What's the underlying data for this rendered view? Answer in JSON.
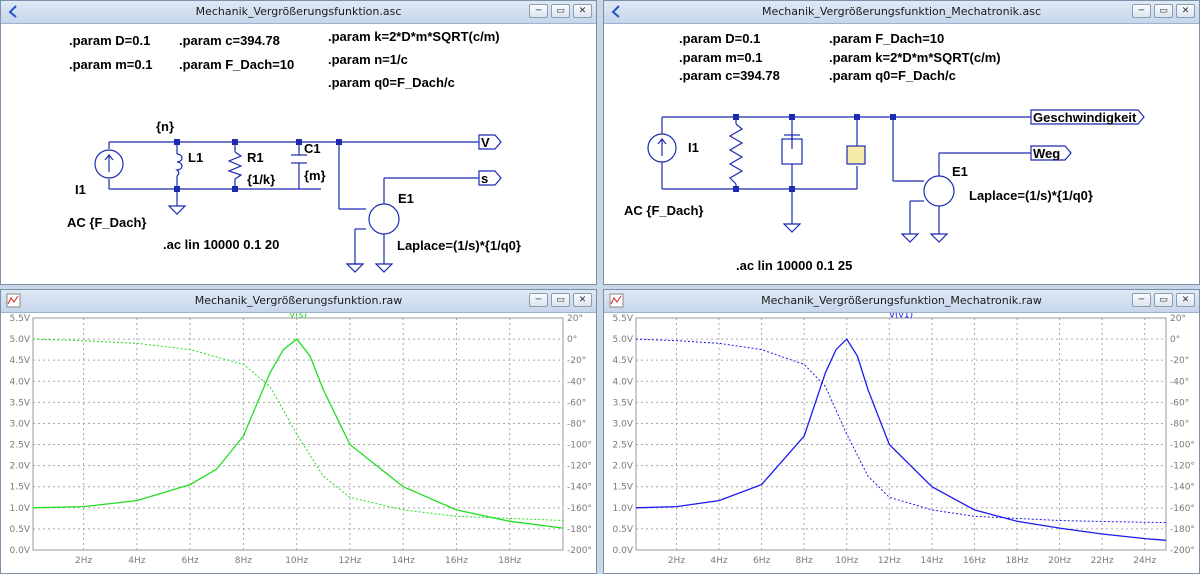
{
  "windows": {
    "sch1": {
      "title": "Mechanik_Vergrößerungsfunktion.asc",
      "params": [
        ".param D=0.1",
        ".param c=394.78",
        ".param k=2*D*m*SQRT(c/m)",
        ".param m=0.1",
        ".param F_Dach=10",
        ".param n=1/c",
        ".param q0=F_Dach/c"
      ],
      "labels": {
        "n": "{n}",
        "L1": "L1",
        "R1": "R1",
        "k": "{1/k}",
        "C1": "C1",
        "m": "{m}",
        "I1": "I1",
        "ac_source": "AC {F_Dach}",
        "V": "V",
        "s": "s",
        "E1": "E1",
        "laplace": "Laplace=(1/s)*{1/q0}",
        "ac_cmd": ".ac lin 10000 0.1 20"
      }
    },
    "sch2": {
      "title": "Mechanik_Vergrößerungsfunktion_Mechatronik.asc",
      "params": [
        ".param D=0.1",
        ".param F_Dach=10",
        ".param m=0.1",
        ".param k=2*D*m*SQRT(c/m)",
        ".param c=394.78",
        ".param q0=F_Dach/c"
      ],
      "labels": {
        "I1": "I1",
        "ac_source": "AC {F_Dach}",
        "geschw": "Geschwindigkeit",
        "weg": "Weg",
        "E1": "E1",
        "laplace": "Laplace=(1/s)*{1/q0}",
        "ac_cmd": ".ac lin 10000 0.1 25"
      }
    },
    "plot1": {
      "title": "Mechanik_Vergrößerungsfunktion.raw",
      "trace_label": "V(s)",
      "color": "#22dd22",
      "y_ticks": [
        "5.5V",
        "5.0V",
        "4.5V",
        "4.0V",
        "3.5V",
        "3.0V",
        "2.5V",
        "2.0V",
        "1.5V",
        "1.0V",
        "0.5V",
        "0.0V"
      ],
      "phase_ticks": [
        "20°",
        "0°",
        "-20°",
        "-40°",
        "-60°",
        "-80°",
        "-100°",
        "-120°",
        "-140°",
        "-160°",
        "-180°",
        "-200°"
      ],
      "x_ticks": [
        "2Hz",
        "4Hz",
        "6Hz",
        "8Hz",
        "10Hz",
        "12Hz",
        "14Hz",
        "16Hz",
        "18Hz"
      ]
    },
    "plot2": {
      "title": "Mechanik_Vergrößerungsfunktion_Mechatronik.raw",
      "trace_label": "V(v1)",
      "color": "#1a1aee",
      "y_ticks": [
        "5.5V",
        "5.0V",
        "4.5V",
        "4.0V",
        "3.5V",
        "3.0V",
        "2.5V",
        "2.0V",
        "1.5V",
        "1.0V",
        "0.5V",
        "0.0V"
      ],
      "phase_ticks": [
        "20°",
        "0°",
        "-20°",
        "-40°",
        "-60°",
        "-80°",
        "-100°",
        "-120°",
        "-140°",
        "-160°",
        "-180°",
        "-200°"
      ],
      "x_ticks": [
        "2Hz",
        "4Hz",
        "6Hz",
        "8Hz",
        "10Hz",
        "12Hz",
        "14Hz",
        "16Hz",
        "18Hz",
        "20Hz",
        "22Hz",
        "24Hz"
      ]
    }
  },
  "chart_data": [
    {
      "type": "line",
      "title": "",
      "series": [
        {
          "name": "V(s)",
          "kind": "magnitude",
          "unit": "V",
          "x": [
            0.1,
            2,
            4,
            6,
            7,
            8,
            9,
            9.5,
            10,
            10.5,
            11,
            12,
            14,
            16,
            18,
            20
          ],
          "values": [
            1.0,
            1.03,
            1.17,
            1.55,
            1.92,
            2.7,
            4.2,
            4.75,
            5.0,
            4.6,
            3.8,
            2.5,
            1.5,
            0.95,
            0.68,
            0.52
          ]
        },
        {
          "name": "V(s) phase",
          "kind": "phase",
          "unit": "deg",
          "x": [
            0.1,
            2,
            4,
            6,
            8,
            9,
            10,
            11,
            12,
            14,
            16,
            18,
            20
          ],
          "values": [
            0,
            -1.5,
            -4,
            -10,
            -24,
            -45,
            -90,
            -130,
            -150,
            -162,
            -168,
            -170,
            -172
          ]
        }
      ],
      "xlim": [
        0.1,
        20
      ],
      "ylim": [
        0,
        5.5
      ],
      "phase_lim": [
        -200,
        20
      ],
      "grid": true
    },
    {
      "type": "line",
      "title": "",
      "series": [
        {
          "name": "V(v1)",
          "kind": "magnitude",
          "unit": "V",
          "x": [
            0.1,
            2,
            4,
            6,
            8,
            9,
            9.5,
            10,
            10.5,
            11,
            12,
            14,
            16,
            18,
            20,
            22,
            24,
            25
          ],
          "values": [
            1.0,
            1.03,
            1.17,
            1.55,
            2.7,
            4.2,
            4.75,
            5.0,
            4.6,
            3.8,
            2.5,
            1.5,
            0.95,
            0.68,
            0.52,
            0.38,
            0.27,
            0.23
          ]
        },
        {
          "name": "V(v1) phase",
          "kind": "phase",
          "unit": "deg",
          "x": [
            0.1,
            2,
            4,
            6,
            8,
            9,
            10,
            11,
            12,
            14,
            16,
            18,
            20,
            22,
            25
          ],
          "values": [
            0,
            -1.5,
            -4,
            -10,
            -24,
            -45,
            -90,
            -130,
            -150,
            -162,
            -168,
            -170,
            -172,
            -173,
            -174
          ]
        }
      ],
      "xlim": [
        0.1,
        25
      ],
      "ylim": [
        0,
        5.5
      ],
      "phase_lim": [
        -200,
        20
      ],
      "grid": true
    }
  ]
}
